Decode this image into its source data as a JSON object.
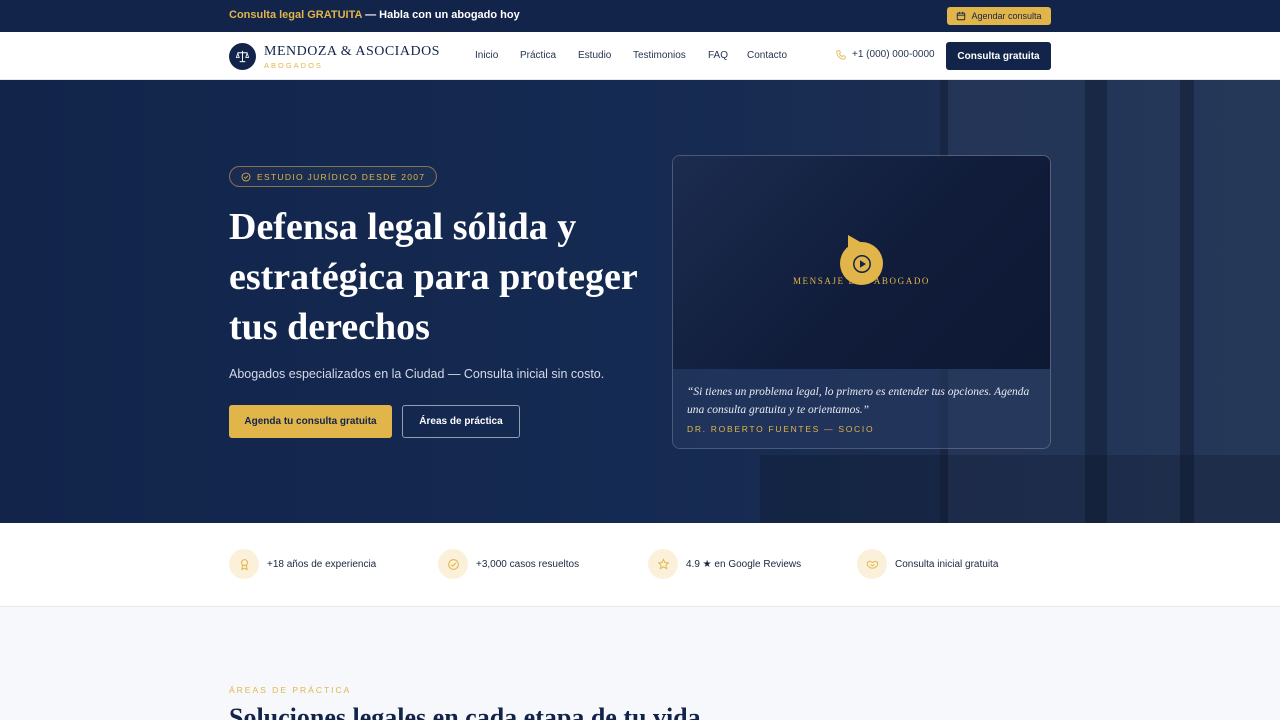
{
  "topbar": {
    "promo_highlight": "Consulta legal GRATUITA",
    "promo_rest": " — Habla con un abogado hoy",
    "cta_label": "Agendar consulta",
    "cta_icon": "calendar-icon"
  },
  "brand": {
    "name": "MENDOZA & ASOCIADOS",
    "tagline": "ABOGADOS",
    "logo_icon": "scales-icon"
  },
  "nav": {
    "links": [
      "Inicio",
      "Práctica",
      "Estudio",
      "Testimonios",
      "FAQ",
      "Contacto"
    ],
    "phone": "+1 (000) 000-0000",
    "phone_icon": "phone-icon",
    "cta_label": "Consulta gratuita"
  },
  "hero": {
    "badge": "ESTUDIO JURÍDICO DESDE 2007",
    "title": "Defensa legal sólida y estratégica para proteger tus derechos",
    "subtitle": "Abogados especializados en la Ciudad — Consulta inicial sin costo.",
    "primary_cta": "Agenda tu consulta gratuita",
    "secondary_cta": "Áreas de práctica",
    "video": {
      "label": "MENSAJE DEL ABOGADO",
      "quote": "“Si tienes un problema legal, lo primero es entender tus opciones. Agenda una consulta gratuita y te orientamos.”",
      "author": "DR. ROBERTO FUENTES — SOCIO"
    }
  },
  "stats": [
    {
      "icon": "award-icon",
      "label": "+18 años de experiencia"
    },
    {
      "icon": "check-circle-icon",
      "label": "+3,000 casos resueltos"
    },
    {
      "icon": "star-icon",
      "label": "4.9 ★ en Google Reviews"
    },
    {
      "icon": "handshake-icon",
      "label": "Consulta inicial gratuita"
    }
  ],
  "practice": {
    "eyebrow": "ÁREAS DE PRÁCTICA",
    "title": "Soluciones legales en cada etapa de tu vida"
  },
  "colors": {
    "navy": "#12244a",
    "gold": "#e2b54b",
    "white": "#ffffff",
    "light_bg": "#f6f8fb"
  }
}
